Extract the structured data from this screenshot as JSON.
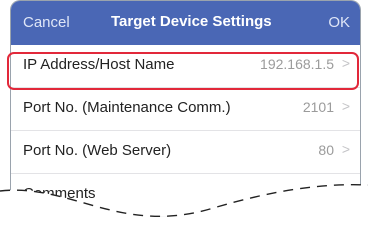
{
  "navbar": {
    "cancel_label": "Cancel",
    "title": "Target Device Settings",
    "ok_label": "OK"
  },
  "settings": [
    {
      "label": "IP Address/Host Name",
      "value": "192.168.1.5",
      "chevron": ">"
    },
    {
      "label": "Port No. (Maintenance Comm.)",
      "value": "2101",
      "chevron": ">"
    },
    {
      "label": "Port No. (Web Server)",
      "value": "80",
      "chevron": ">"
    },
    {
      "label": "Comments",
      "value": "",
      "chevron": ">"
    }
  ],
  "colors": {
    "navbar": "#4a67b5",
    "highlight": "#e2283a"
  },
  "icons": {
    "chevron": "chevron-right-icon"
  }
}
